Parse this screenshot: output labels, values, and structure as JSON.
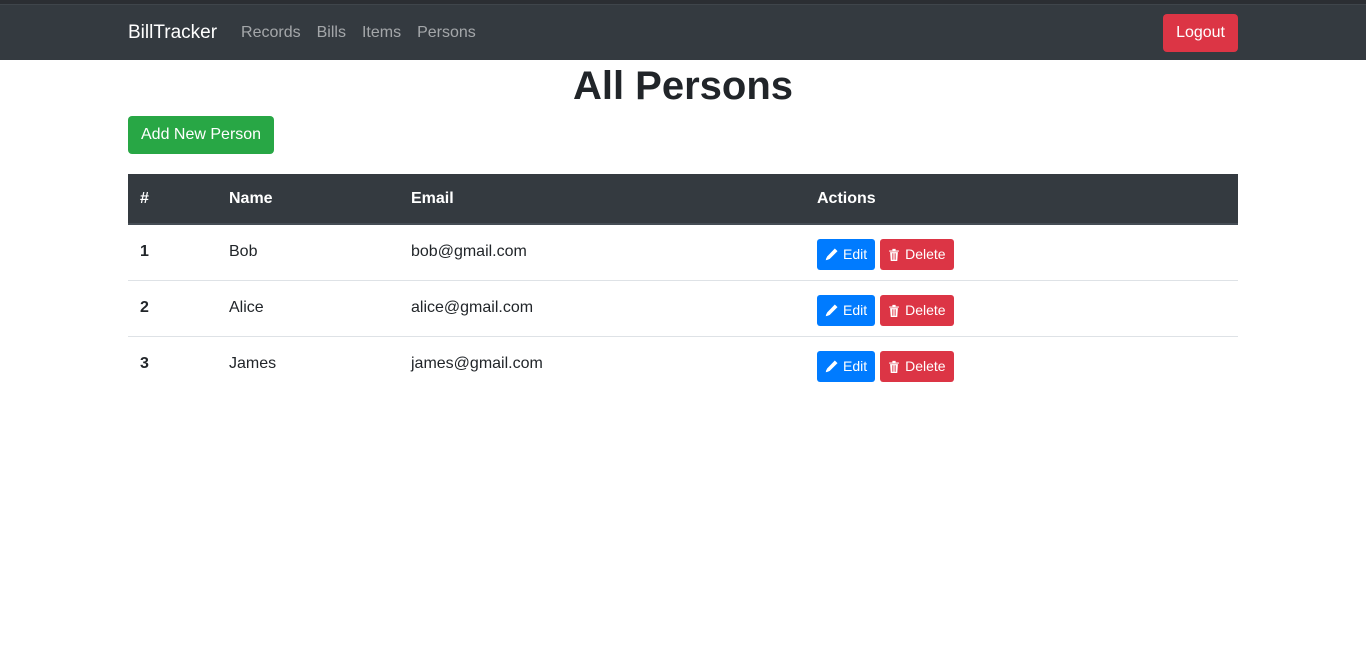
{
  "navbar": {
    "brand": "BillTracker",
    "links": [
      "Records",
      "Bills",
      "Items",
      "Persons"
    ],
    "logout_label": "Logout"
  },
  "main": {
    "title": "All Persons",
    "add_button_label": "Add New Person",
    "table": {
      "columns": [
        "#",
        "Name",
        "Email",
        "Actions"
      ],
      "rows": [
        {
          "num": "1",
          "name": "Bob",
          "email": "bob@gmail.com"
        },
        {
          "num": "2",
          "name": "Alice",
          "email": "alice@gmail.com"
        },
        {
          "num": "3",
          "name": "James",
          "email": "james@gmail.com"
        }
      ],
      "edit_label": "Edit",
      "delete_label": "Delete"
    }
  },
  "icons": {
    "edit": "pencil-icon",
    "delete": "trash-icon"
  },
  "colors": {
    "navbar_bg": "#343a40",
    "primary": "#007bff",
    "danger": "#dc3545",
    "success": "#28a745"
  }
}
